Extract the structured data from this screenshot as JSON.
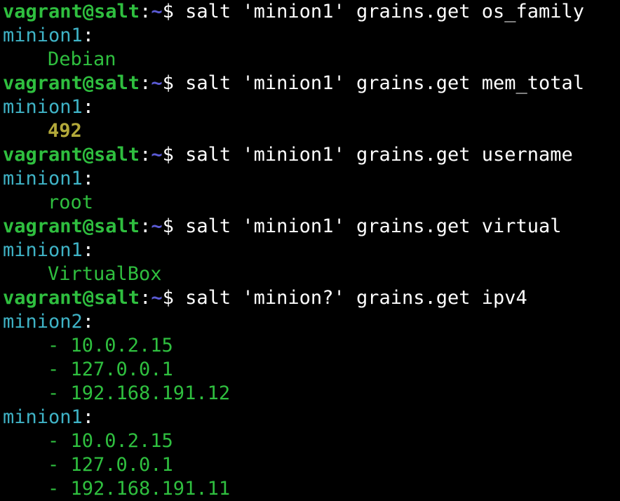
{
  "prompt": {
    "user": "vagrant@salt",
    "separator": ":",
    "path": "~",
    "symbol": "$ "
  },
  "blocks": [
    {
      "command": "salt 'minion1' grains.get os_family",
      "results": [
        {
          "minion": "minion1",
          "values": [
            {
              "text": "Debian",
              "style": "green"
            }
          ]
        }
      ]
    },
    {
      "command": "salt 'minion1' grains.get mem_total",
      "results": [
        {
          "minion": "minion1",
          "values": [
            {
              "text": "492",
              "style": "yellow"
            }
          ]
        }
      ]
    },
    {
      "command": "salt 'minion1' grains.get username",
      "results": [
        {
          "minion": "minion1",
          "values": [
            {
              "text": "root",
              "style": "green"
            }
          ]
        }
      ]
    },
    {
      "command": "salt 'minion1' grains.get virtual",
      "results": [
        {
          "minion": "minion1",
          "values": [
            {
              "text": "VirtualBox",
              "style": "green"
            }
          ]
        }
      ]
    },
    {
      "command": "salt 'minion?' grains.get ipv4",
      "results": [
        {
          "minion": "minion2",
          "values": [
            {
              "text": "- 10.0.2.15",
              "style": "green"
            },
            {
              "text": "- 127.0.0.1",
              "style": "green"
            },
            {
              "text": "- 192.168.191.12",
              "style": "green"
            }
          ]
        },
        {
          "minion": "minion1",
          "values": [
            {
              "text": "- 10.0.2.15",
              "style": "green"
            },
            {
              "text": "- 127.0.0.1",
              "style": "green"
            },
            {
              "text": "- 192.168.191.11",
              "style": "green"
            }
          ]
        }
      ]
    }
  ],
  "colors": {
    "background": "#000000",
    "user": "#2fbf3f",
    "path": "#5b5bd6",
    "minion": "#3fb3c6",
    "value": "#2fbf3f",
    "number": "#b3a93a"
  }
}
